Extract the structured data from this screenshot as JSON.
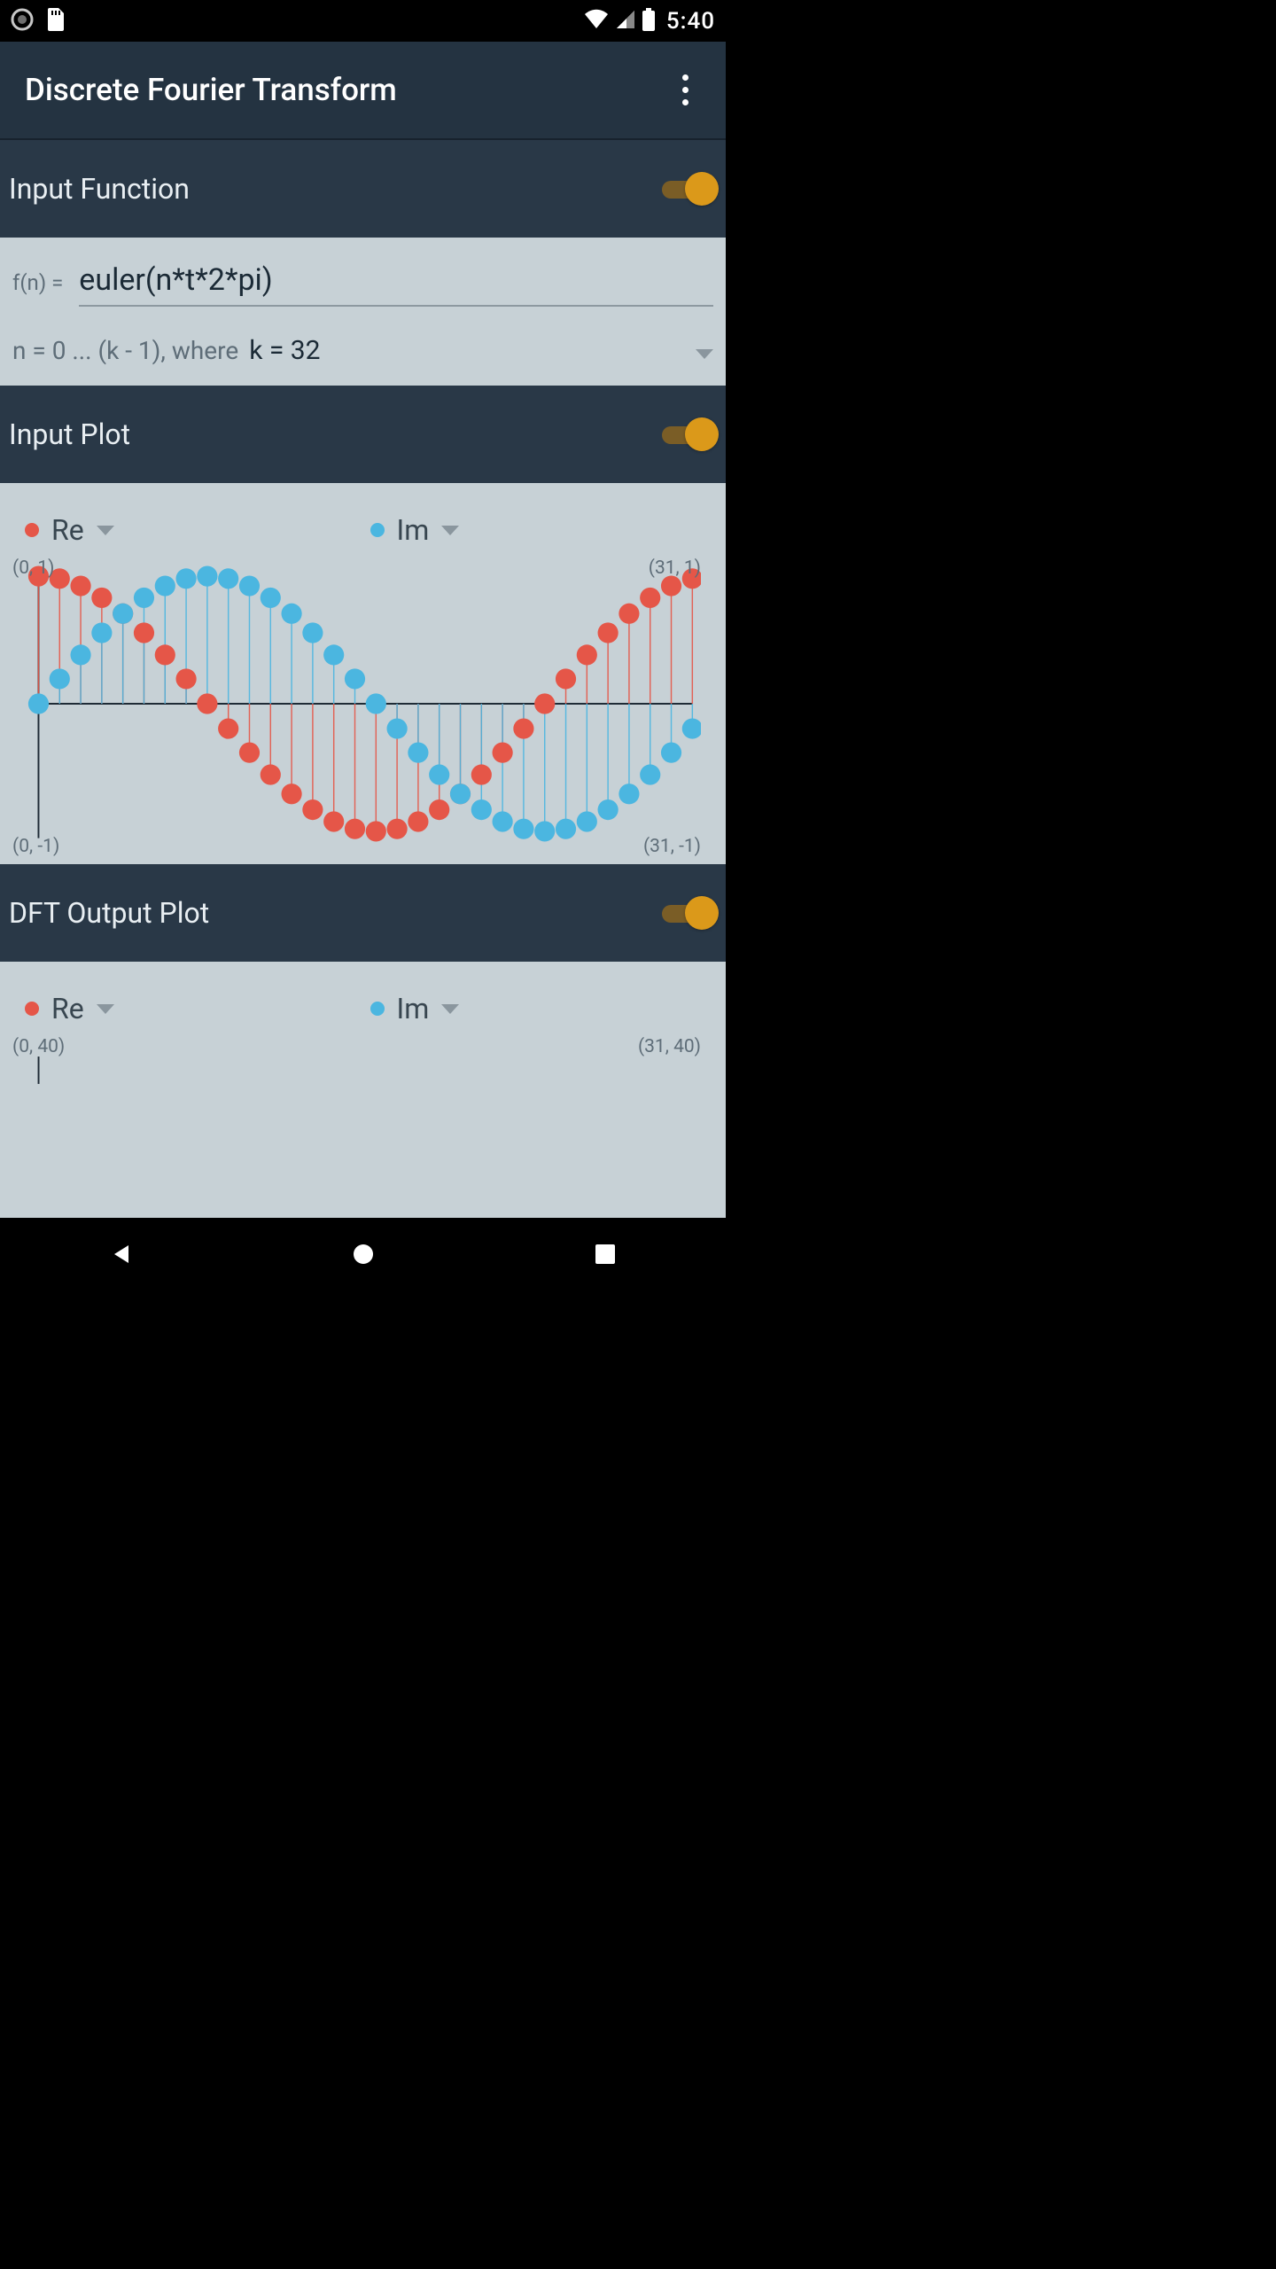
{
  "status": {
    "clock": "5:40"
  },
  "app": {
    "title": "Discrete Fourier Transform"
  },
  "sections": {
    "input_function": {
      "title": "Input Function",
      "enabled": true
    },
    "input_plot": {
      "title": "Input Plot",
      "enabled": true
    },
    "dft_output_plot": {
      "title": "DFT Output Plot",
      "enabled": true
    }
  },
  "input_function": {
    "fn_label": "f(n) =",
    "fn_value": "euler(n*t*2*pi)",
    "k_label": "n = 0 ... (k - 1), where",
    "k_value": "k = 32"
  },
  "legend": {
    "re_label": "Re",
    "im_label": "Im"
  },
  "input_plot_labels": {
    "top_left": "(0, 1)",
    "top_right": "(31, 1)",
    "bottom_left": "(0, -1)",
    "bottom_right": "(31, -1)"
  },
  "dft_plot_labels": {
    "top_left": "(0, 40)",
    "top_right": "(31, 40)"
  },
  "colors": {
    "accent": "#db991a",
    "re": "#e55648",
    "im": "#4bb6e0",
    "header_bg": "#293847",
    "appbar_bg": "#243341",
    "panel_bg": "#c7d1d6"
  },
  "chart_data": {
    "type": "scatter",
    "title": "Input Plot",
    "xlabel": "",
    "ylabel": "",
    "xlim": [
      0,
      31
    ],
    "ylim": [
      -1,
      1
    ],
    "x": [
      0,
      1,
      2,
      3,
      4,
      5,
      6,
      7,
      8,
      9,
      10,
      11,
      12,
      13,
      14,
      15,
      16,
      17,
      18,
      19,
      20,
      21,
      22,
      23,
      24,
      25,
      26,
      27,
      28,
      29,
      30,
      31
    ],
    "series": [
      {
        "name": "Re",
        "color": "#e55648",
        "values": [
          1.0,
          0.981,
          0.924,
          0.831,
          0.707,
          0.556,
          0.383,
          0.195,
          0.0,
          -0.195,
          -0.383,
          -0.556,
          -0.707,
          -0.831,
          -0.924,
          -0.981,
          -1.0,
          -0.981,
          -0.924,
          -0.831,
          -0.707,
          -0.556,
          -0.383,
          -0.195,
          0.0,
          0.195,
          0.383,
          0.556,
          0.707,
          0.831,
          0.924,
          0.981
        ]
      },
      {
        "name": "Im",
        "color": "#4bb6e0",
        "values": [
          0.0,
          0.195,
          0.383,
          0.556,
          0.707,
          0.831,
          0.924,
          0.981,
          1.0,
          0.981,
          0.924,
          0.831,
          0.707,
          0.556,
          0.383,
          0.195,
          0.0,
          -0.195,
          -0.383,
          -0.556,
          -0.707,
          -0.831,
          -0.924,
          -0.981,
          -1.0,
          -0.981,
          -0.924,
          -0.831,
          -0.707,
          -0.556,
          -0.383,
          -0.195
        ]
      }
    ]
  }
}
